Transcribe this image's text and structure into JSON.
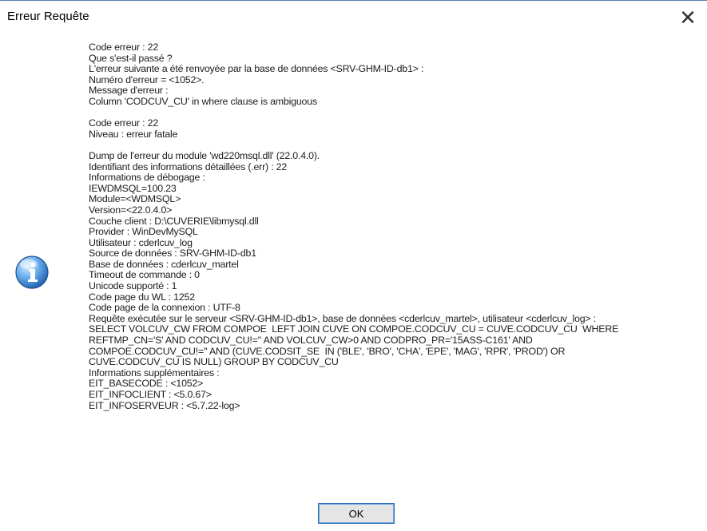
{
  "dialog": {
    "title": "Erreur Requête",
    "close_label": "✕",
    "icon": "information-icon",
    "ok_label": "OK",
    "accent": "#2d6fb8"
  },
  "message": {
    "blocks": [
      [
        "Code erreur : 22",
        "Que s'est-il passé ?",
        "L'erreur suivante a été renvoyée par la base de données <SRV-GHM-ID-db1> :",
        "Numéro d'erreur = <1052>.",
        "Message d'erreur :",
        "Column 'CODCUV_CU' in where clause is ambiguous"
      ],
      [
        "Code erreur : 22",
        "Niveau : erreur fatale"
      ],
      [
        "Dump de l'erreur du module 'wd220msql.dll' (22.0.4.0).",
        "Identifiant des informations détaillées (.err) : 22",
        "Informations de débogage :",
        "IEWDMSQL=100.23",
        "Module=<WDMSQL>",
        "Version=<22.0.4.0>",
        "Couche client : D:\\CUVERIE\\libmysql.dll",
        "Provider : WinDevMySQL",
        "Utilisateur : cderlcuv_log",
        "Source de données : SRV-GHM-ID-db1",
        "Base de données : cderlcuv_martel",
        "Timeout de commande : 0",
        "Unicode supporté : 1",
        "Code page du WL : 1252",
        "Code page de la connexion : UTF-8",
        "Requête exécutée sur le serveur <SRV-GHM-ID-db1>, base de données <cderlcuv_martel>, utilisateur <cderlcuv_log> :",
        "SELECT VOLCUV_CW FROM COMPOE  LEFT JOIN CUVE ON COMPOE.CODCUV_CU = CUVE.CODCUV_CU  WHERE",
        "REFTMP_CN='S' AND CODCUV_CU!='' AND VOLCUV_CW>0 AND CODPRO_PR='15ASS-C161' AND",
        "COMPOE.CODCUV_CU!='' AND (CUVE.CODSIT_SE  IN ('BLE', 'BRO', 'CHA', 'EPE', 'MAG', 'RPR', 'PROD') OR",
        "CUVE.CODCUV_CU IS NULL) GROUP BY CODCUV_CU",
        "Informations supplémentaires :",
        "EIT_BASECODE : <1052>",
        "EIT_INFOCLIENT : <5.0.67>",
        "EIT_INFOSERVEUR : <5.7.22-log>"
      ]
    ]
  }
}
